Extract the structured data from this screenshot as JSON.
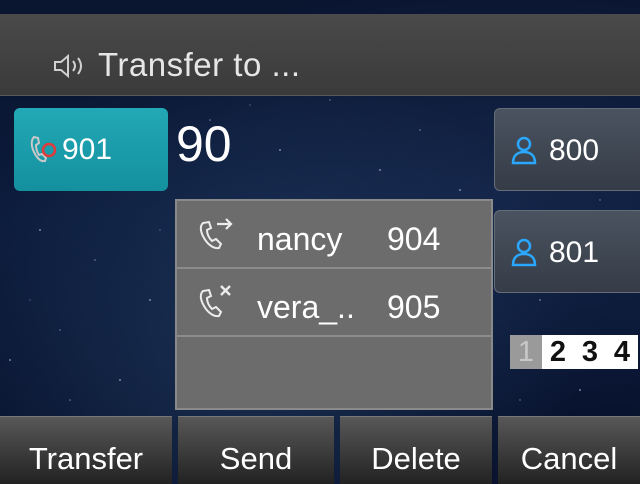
{
  "title_bar": {
    "icon": "speaker-icon",
    "title": "Transfer to ..."
  },
  "line_key": {
    "icon": "handset-recording-icon",
    "label": "901",
    "color": "#1a9ba9"
  },
  "dial_input": {
    "value": "90"
  },
  "speed_keys": [
    {
      "icon": "contact-person-icon",
      "label": "800"
    },
    {
      "icon": "contact-person-icon",
      "label": "801"
    }
  ],
  "suggestions": [
    {
      "icon": "outgoing-call-icon",
      "name": "nancy",
      "number": "904"
    },
    {
      "icon": "missed-call-icon",
      "name": "vera_..",
      "number": "905"
    }
  ],
  "pager": {
    "pages": [
      "1",
      "2",
      "3",
      "4"
    ],
    "active": "1"
  },
  "softkeys": [
    "Transfer",
    "Send",
    "Delete",
    "Cancel"
  ]
}
